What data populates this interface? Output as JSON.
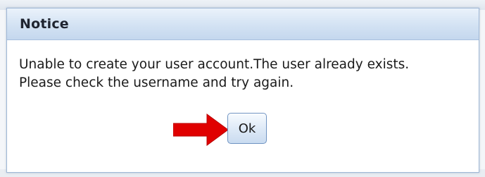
{
  "dialog": {
    "title": "Notice",
    "message_lines": [
      "Unable to create your user account.The user already exists.",
      "Please check the username and try again."
    ],
    "ok_label": "Ok"
  },
  "colors": {
    "titlebar": "#d3e2f3",
    "border": "#9fb7d6",
    "arrow": "#e00000",
    "button": "#dfeaf7"
  },
  "icons": {
    "annotation_arrow": "red-arrow-icon"
  }
}
